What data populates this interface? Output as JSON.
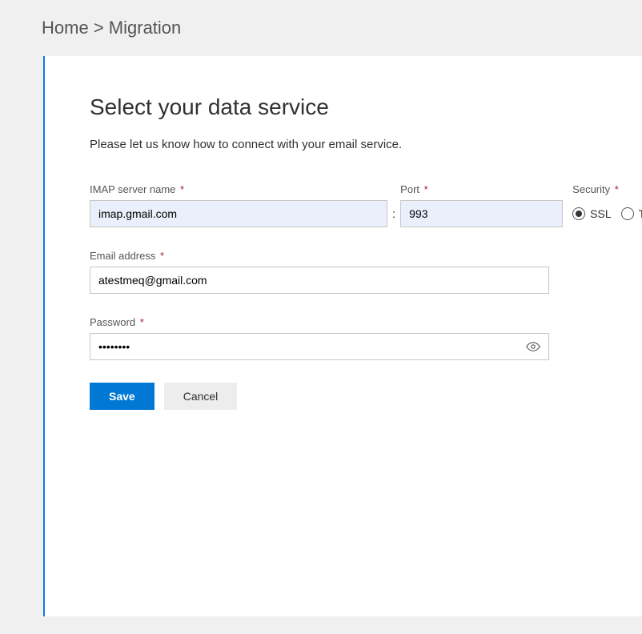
{
  "breadcrumb": {
    "home": "Home",
    "sep": ">",
    "current": "Migration"
  },
  "title": "Select your data service",
  "subtitle": "Please let us know how to connect with your email service.",
  "labels": {
    "imap": "IMAP server name",
    "port": "Port",
    "security": "Security",
    "email": "Email address",
    "password": "Password"
  },
  "values": {
    "imap": "imap.gmail.com",
    "port": "993",
    "email": "atestmeq@gmail.com",
    "password": "••••••••"
  },
  "security": {
    "ssl": "SSL",
    "tls": "TLS",
    "selected": "SSL"
  },
  "buttons": {
    "save": "Save",
    "cancel": "Cancel"
  },
  "required_marker": "*"
}
